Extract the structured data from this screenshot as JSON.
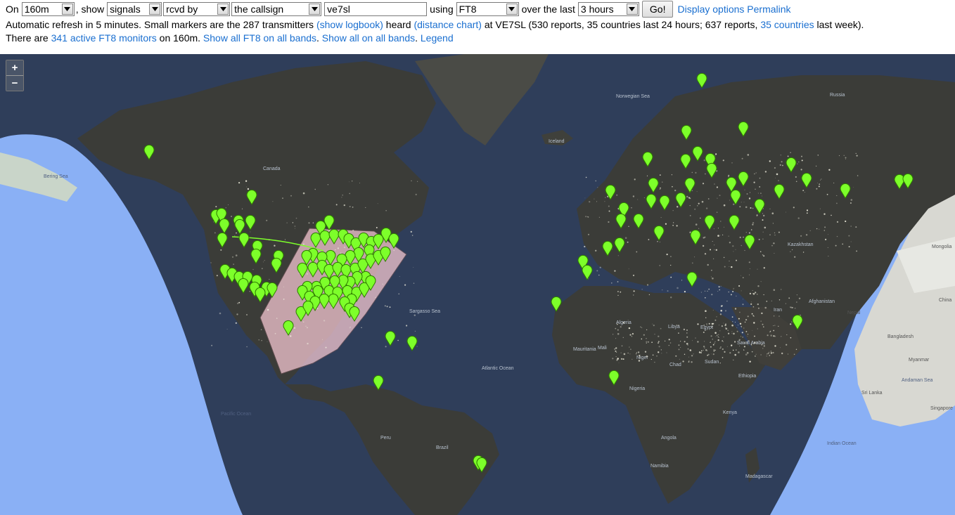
{
  "controls": {
    "on_label": "On",
    "band": "160m",
    "show_label": ", show",
    "show_what": "signals",
    "direction": "rcvd by",
    "who": "the callsign",
    "callsign": "ve7sl",
    "using_label": "using",
    "mode": "FT8",
    "over_label": "over the last",
    "period": "3 hours",
    "go": "Go!",
    "display_options": "Display options",
    "permalink": "Permalink"
  },
  "status": {
    "line2_a": "Automatic refresh in 5 minutes. Small markers are the 287 transmitters ",
    "show_logbook": "(show logbook)",
    "line2_b": " heard ",
    "distance_chart": "(distance chart)",
    "line2_c": " at VE7SL (530 reports, 35 countries last 24 hours; 637 reports, ",
    "countries_link": "35 countries",
    "line2_d": " last week).",
    "line3_a": "There are ",
    "monitors_link": "341 active FT8 monitors",
    "line3_b": " on 160m. ",
    "show_all_ft8": "Show all FT8 on all bands",
    "sep1": ". ",
    "show_all": "Show all on all bands",
    "sep2": ". ",
    "legend": "Legend"
  },
  "map": {
    "zoom_in": "+",
    "zoom_out": "−",
    "colors": {
      "ocean_day": "#8ab0f5",
      "ocean_night": "#2f3e5a",
      "land_night": "#3b3c38",
      "marker": "#7dff2a",
      "cone": "#f3c6d0"
    },
    "place_labels": [
      "Norwegian Sea",
      "Iceland",
      "Bering Sea",
      "Canada",
      "Sargasso Sea",
      "Pacific Ocean",
      "Atlantic Ocean",
      "Algeria",
      "Libya",
      "Egypt",
      "Mali",
      "Niger",
      "Chad",
      "Sudan",
      "Mauritania",
      "Nigeria",
      "Ethiopia",
      "Kenya",
      "Angola",
      "Namibia",
      "Madagascar",
      "Brazil",
      "Peru",
      "Kazakhstan",
      "Mongolia",
      "China",
      "Afghanistan",
      "Iran",
      "Saudi Arabia",
      "Nepal",
      "Myanmar",
      "Andaman Sea",
      "Sri Lanka",
      "Singapore",
      "Indian Ocean",
      "Bangladesh",
      "Russia"
    ]
  }
}
